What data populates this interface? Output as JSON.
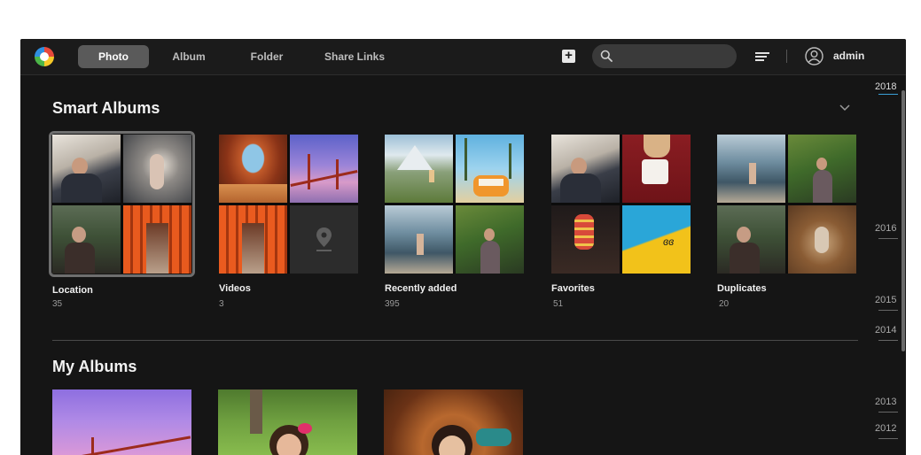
{
  "user": {
    "name": "admin"
  },
  "nav": {
    "tabs": [
      "Photo",
      "Album",
      "Folder",
      "Share Links"
    ],
    "active": "Photo"
  },
  "search": {
    "placeholder": ""
  },
  "smart_albums": {
    "title": "Smart Albums",
    "items": [
      {
        "label": "Location",
        "count": "35",
        "selected": true
      },
      {
        "label": "Videos",
        "count": "3"
      },
      {
        "label": "Recently added",
        "count": "395"
      },
      {
        "label": "Favorites",
        "count": "51"
      },
      {
        "label": "Duplicates",
        "count": "20"
      }
    ]
  },
  "my_albums": {
    "title": "My Albums"
  },
  "timeline": {
    "years": [
      "2018",
      "2016",
      "2015",
      "2014",
      "2013",
      "2012"
    ],
    "active": "2018"
  },
  "colors": {
    "accent": "#3aa0d8",
    "background": "#151515",
    "tab_active": "#5a5a5a"
  },
  "icons": [
    "logo-icon",
    "add-icon",
    "search-icon",
    "sort-icon",
    "user-icon",
    "chevron-down-icon",
    "map-pin-icon"
  ]
}
